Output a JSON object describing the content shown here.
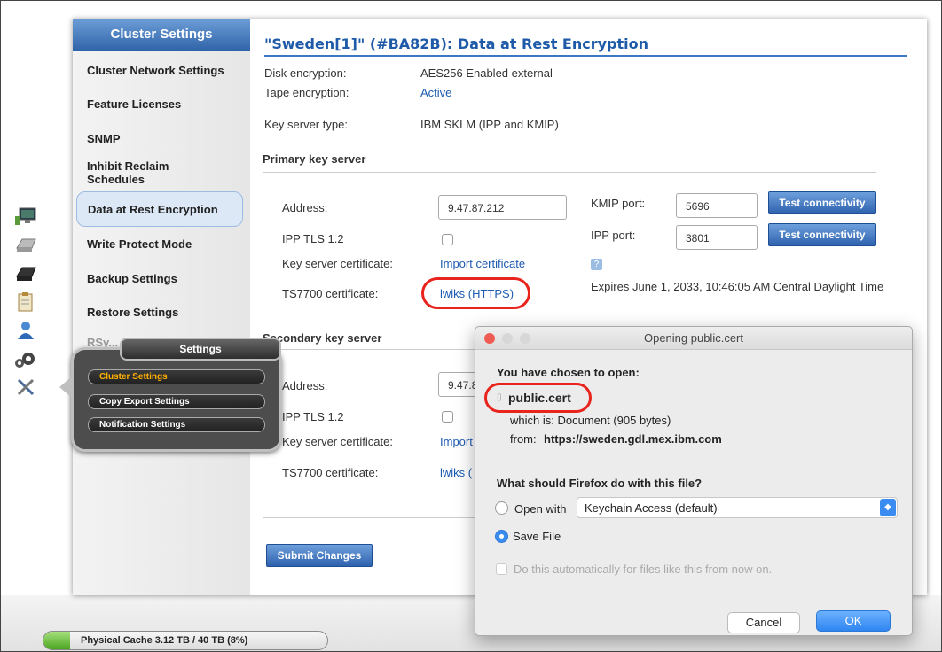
{
  "sidebar": {
    "title": "Cluster Settings",
    "items": [
      {
        "label": "Cluster Network Settings"
      },
      {
        "label": "Feature Licenses"
      },
      {
        "label": "SNMP"
      },
      {
        "label": "Inhibit Reclaim Schedules"
      },
      {
        "label": "Data at Rest Encryption",
        "selected": true
      },
      {
        "label": "Write Protect Mode"
      },
      {
        "label": "Backup Settings"
      },
      {
        "label": "Restore Settings"
      }
    ],
    "obscured_item": "RSy..."
  },
  "main": {
    "title": "\"Sweden[1]\" (#BA82B): Data at Rest Encryption",
    "disk_encryption": {
      "label": "Disk encryption:",
      "value": "AES256 Enabled external"
    },
    "tape_encryption": {
      "label": "Tape encryption:",
      "value": "Active"
    },
    "key_server_type": {
      "label": "Key server type:",
      "value": "IBM SKLM (IPP and KMIP)"
    },
    "primary": {
      "heading": "Primary key server",
      "address_label": "Address:",
      "address_value": "9.47.87.212",
      "kmip_label": "KMIP port:",
      "kmip_value": "5696",
      "ipp_port_label": "IPP port:",
      "ipp_port_value": "3801",
      "test_button": "Test connectivity",
      "ipp_tls_label": "IPP TLS 1.2",
      "cert_label": "Key server certificate:",
      "cert_link": "Import certificate",
      "help": "?",
      "ts_label": "TS7700 certificate:",
      "ts_link": "lwiks (HTTPS)",
      "expires": "Expires June 1, 2033, 10:46:05 AM Central Daylight Time"
    },
    "secondary": {
      "heading": "Secondary key server",
      "address_label": "Address:",
      "address_value": "9.47.8",
      "ipp_tls_label": "IPP TLS 1.2",
      "cert_label": "Key server certificate:",
      "cert_link": "Import",
      "ts_label": "TS7700 certificate:",
      "ts_link": "lwiks ("
    },
    "submit_button": "Submit Changes"
  },
  "settings_popup": {
    "title": "Settings",
    "items": [
      {
        "label": "Cluster Settings",
        "active": true
      },
      {
        "label": "Copy Export Settings"
      },
      {
        "label": "Notification Settings"
      }
    ]
  },
  "dialog": {
    "title": "Opening public.cert",
    "chosen": "You have chosen to open:",
    "filename": "public.cert",
    "which_is": "which is: Document (905 bytes)",
    "from_label": "from:",
    "from_url": "https://sweden.gdl.mex.ibm.com",
    "question": "What should Firefox do with this file?",
    "open_with": "Open with",
    "app": "Keychain Access (default)",
    "save_file": "Save File",
    "auto": "Do this automatically for files like this from now on.",
    "cancel": "Cancel",
    "ok": "OK"
  },
  "status": {
    "cache_text": "Physical Cache 3.12 TB / 40 TB (8%)",
    "cache_fraction": 0.08
  },
  "colors": {
    "accent": "#2f63a8",
    "link": "#1d5bb1",
    "highlight": "#e8241c",
    "mac_blue": "#3b8cf0"
  }
}
